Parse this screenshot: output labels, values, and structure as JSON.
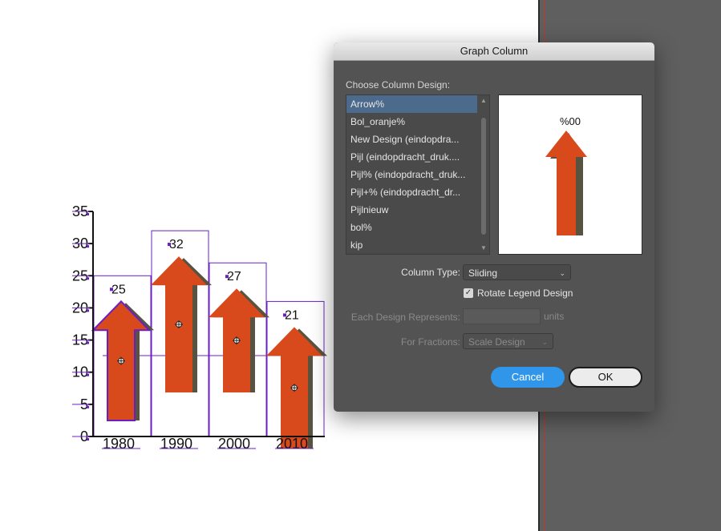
{
  "chart_data": {
    "type": "bar",
    "categories": [
      "1980",
      "1990",
      "2000",
      "2010"
    ],
    "values": [
      25,
      32,
      27,
      21
    ],
    "ylim": [
      0,
      35
    ],
    "yticks": [
      "0",
      "5",
      "10",
      "15",
      "20",
      "25",
      "30",
      "35"
    ],
    "title": "",
    "xlabel": "",
    "ylabel": "",
    "colors": {
      "arrow": "#d84a1b",
      "shadow": "#585340",
      "frame": "#6a1fc4"
    }
  },
  "dialog": {
    "title": "Graph Column",
    "choose_label": "Choose Column Design:",
    "designs": [
      "Arrow%",
      "Bol_oranje%",
      "New Design  (eindopdra...",
      "Pijl (eindopdracht_druk....",
      "Pijl% (eindopdracht_druk...",
      "Pijl+% (eindopdracht_dr...",
      "Pijlnieuw",
      "bol%",
      "kip"
    ],
    "preview_label": "%00",
    "column_type_label": "Column Type:",
    "column_type_value": "Sliding",
    "rotate_label": "Rotate Legend Design",
    "each_label": "Each Design Represents:",
    "units_label": "units",
    "fractions_label": "For Fractions:",
    "fractions_value": "Scale Design",
    "cancel_label": "Cancel",
    "ok_label": "OK"
  }
}
